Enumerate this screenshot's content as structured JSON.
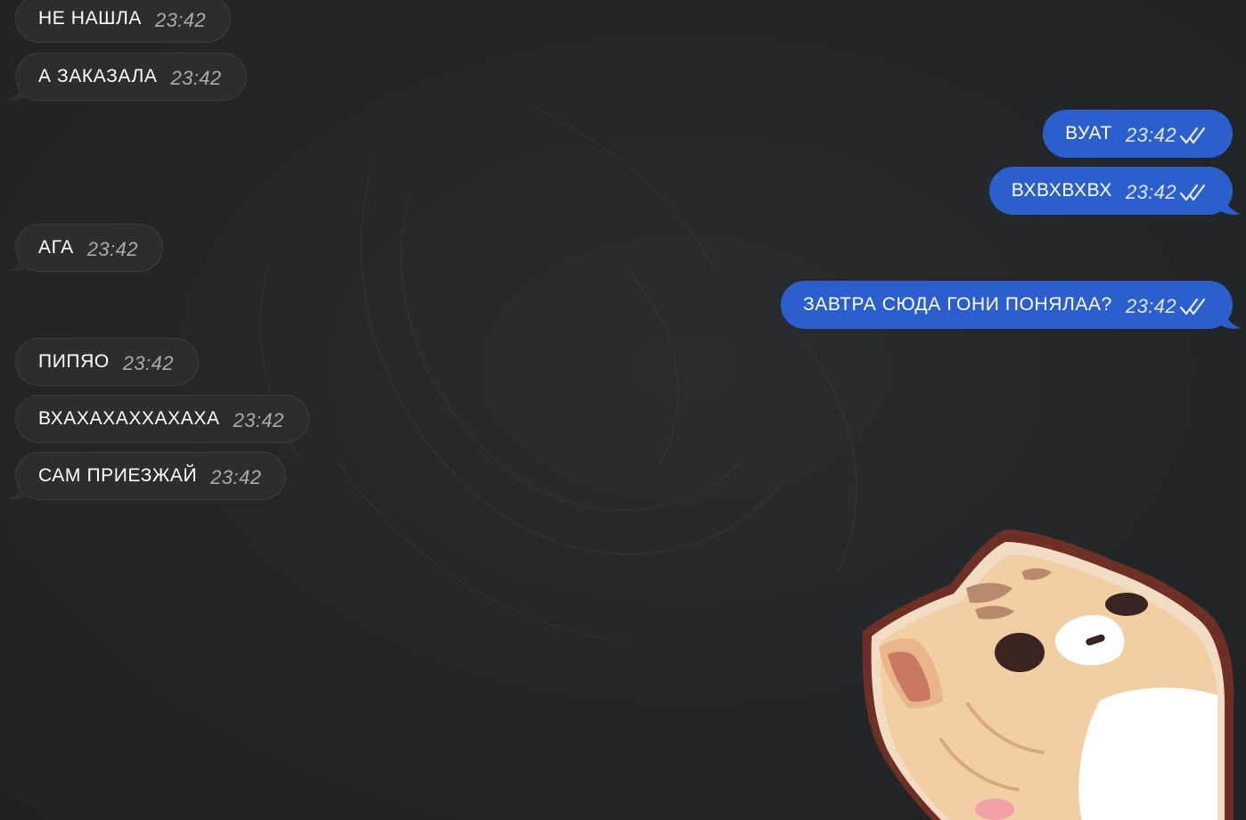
{
  "messages": [
    {
      "direction": "in",
      "text": "НЕ НАШЛА",
      "time": "23:42"
    },
    {
      "direction": "in",
      "text": "А ЗАКАЗАЛА",
      "time": "23:42"
    },
    {
      "direction": "out",
      "text": "ВУАТ",
      "time": "23:42",
      "status": "read"
    },
    {
      "direction": "out",
      "text": "ВХВХВХВХ",
      "time": "23:42",
      "status": "read"
    },
    {
      "direction": "in",
      "text": "АГА",
      "time": "23:42"
    },
    {
      "direction": "out",
      "text": "ЗАВТРА СЮДА ГОНИ ПОНЯЛАА?",
      "time": "23:42",
      "status": "read"
    },
    {
      "direction": "in",
      "text": "ПИПЯО",
      "time": "23:42"
    },
    {
      "direction": "in",
      "text": "ВХАХАХАХХАХАХА",
      "time": "23:42"
    },
    {
      "direction": "in",
      "text": "САМ ПРИЕЗЖАЙ",
      "time": "23:42"
    }
  ],
  "sticker": {
    "icon": "cat-sticker-icon"
  },
  "colors": {
    "background": "#232628",
    "incoming_bubble": "#2b2d30",
    "outgoing_bubble": "#2b5fce"
  }
}
